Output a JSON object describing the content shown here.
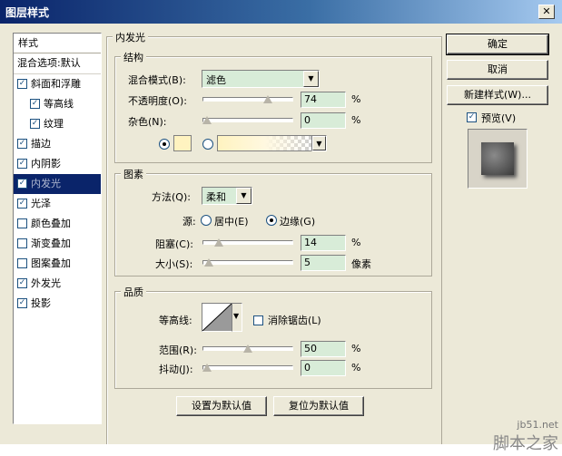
{
  "window": {
    "title": "图层样式",
    "close_glyph": "✕"
  },
  "sidebar": {
    "header": "样式",
    "blend_default": "混合选项:默认",
    "items": [
      {
        "label": "斜面和浮雕",
        "checked": true
      },
      {
        "label": "等高线",
        "checked": true
      },
      {
        "label": "纹理",
        "checked": true
      },
      {
        "label": "描边",
        "checked": true
      },
      {
        "label": "内阴影",
        "checked": true
      },
      {
        "label": "内发光",
        "checked": true,
        "selected": true
      },
      {
        "label": "光泽",
        "checked": true
      },
      {
        "label": "颜色叠加",
        "checked": false
      },
      {
        "label": "渐变叠加",
        "checked": false
      },
      {
        "label": "图案叠加",
        "checked": false
      },
      {
        "label": "外发光",
        "checked": true
      },
      {
        "label": "投影",
        "checked": true
      }
    ]
  },
  "panel": {
    "title": "内发光",
    "structure": {
      "label": "结构",
      "blend_mode_label": "混合模式(B):",
      "blend_mode_value": "滤色",
      "opacity_label": "不透明度(O):",
      "opacity_value": "74",
      "opacity_unit": "%",
      "opacity_level": 0.74,
      "noise_label": "杂色(N):",
      "noise_value": "0",
      "noise_unit": "%",
      "noise_level": 0,
      "color_swatch": "#fff3c0"
    },
    "elements": {
      "label": "图素",
      "method_label": "方法(Q):",
      "method_value": "柔和",
      "source_label": "源:",
      "source_center": "居中(E)",
      "source_edge": "边缘(G)",
      "choke_label": "阻塞(C):",
      "choke_value": "14",
      "choke_unit": "%",
      "choke_level": 0.14,
      "size_label": "大小(S):",
      "size_value": "5",
      "size_unit": "像素",
      "size_level": 0.02
    },
    "quality": {
      "label": "品质",
      "contour_label": "等高线:",
      "antialias_label": "消除锯齿(L)",
      "range_label": "范围(R):",
      "range_value": "50",
      "range_unit": "%",
      "range_level": 0.5,
      "jitter_label": "抖动(J):",
      "jitter_value": "0",
      "jitter_unit": "%",
      "jitter_level": 0
    },
    "make_default": "设置为默认值",
    "reset_default": "复位为默认值"
  },
  "right": {
    "ok": "确定",
    "cancel": "取消",
    "new_style": "新建样式(W)...",
    "preview_label": "预览(V)"
  },
  "watermark": {
    "line1": "jb51.net",
    "line2": "脚本之家"
  }
}
